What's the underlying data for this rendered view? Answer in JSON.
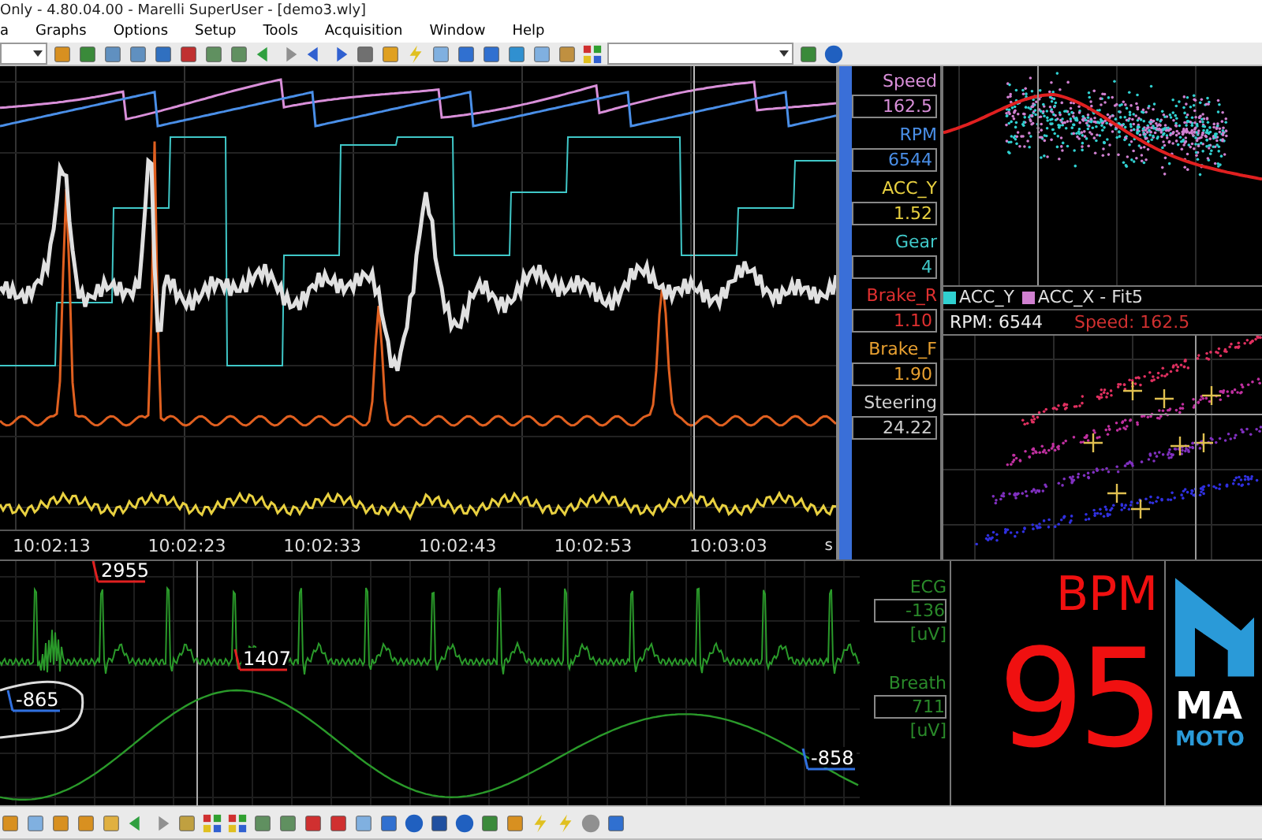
{
  "window": {
    "title": "Only - 4.80.04.00 - Marelli SuperUser - [demo3.wly]"
  },
  "menu": [
    {
      "label": "a"
    },
    {
      "label": "Graphs"
    },
    {
      "label": "Options"
    },
    {
      "label": "Setup"
    },
    {
      "label": "Tools"
    },
    {
      "label": "Acquisition"
    },
    {
      "label": "Window"
    },
    {
      "label": "Help"
    }
  ],
  "main_chart": {
    "channels": [
      {
        "name": "Speed",
        "value": "162.5",
        "color": "#d98fd9"
      },
      {
        "name": "RPM",
        "value": "6544",
        "color": "#4a8fe8"
      },
      {
        "name": "ACC_Y",
        "value": "1.52",
        "color": "#e8d040"
      },
      {
        "name": "Gear",
        "value": "4",
        "color": "#40c8c8"
      },
      {
        "name": "Brake_R",
        "value": "1.10",
        "color": "#e03030"
      },
      {
        "name": "Brake_F",
        "value": "1.90",
        "color": "#e8a030"
      },
      {
        "name": "Steering",
        "value": "24.22",
        "color": "#d0d0d0"
      }
    ],
    "time_axis": {
      "labels": [
        "10:02:13",
        "10:02:23",
        "10:02:33",
        "10:02:43",
        "10:02:53",
        "10:03:03"
      ],
      "unit": "s"
    }
  },
  "scatter": {
    "legend": [
      {
        "label": "ACC_Y",
        "color": "#30d0d0"
      },
      {
        "label": "ACC_X - Fit5",
        "color": "#d080d0"
      }
    ],
    "readout": {
      "rpm": "RPM: 6544",
      "speed": "Speed: 162.5"
    }
  },
  "bio_chart": {
    "markers": [
      {
        "label": "2955",
        "color": "#e02020"
      },
      {
        "label": "1407",
        "color": "#e02020"
      },
      {
        "label": "-865",
        "color": "#3070e0"
      },
      {
        "label": "-858",
        "color": "#3070e0"
      }
    ],
    "channels": [
      {
        "name": "ECG",
        "value": "-136",
        "unit": "[uV]"
      },
      {
        "name": "Breath",
        "value": "711",
        "unit": "[uV]"
      }
    ]
  },
  "bpm": {
    "label": "BPM",
    "value": "95"
  },
  "logo": {
    "line_1": "MA",
    "line_2": "MOTO"
  }
}
